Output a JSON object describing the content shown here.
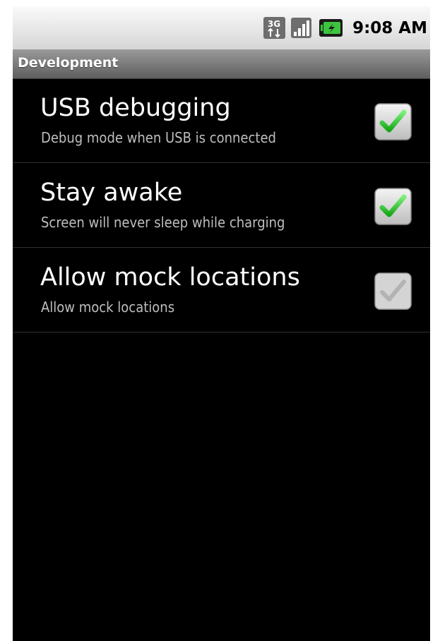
{
  "status_bar": {
    "time": "9:08 AM",
    "icons": [
      "3g-data-icon",
      "signal-strength-icon",
      "battery-charging-icon"
    ],
    "network_label": "3G"
  },
  "title_bar": {
    "title": "Development"
  },
  "preferences": [
    {
      "title": "USB debugging",
      "summary": "Debug mode when USB is connected",
      "checked": true,
      "enabled": true
    },
    {
      "title": "Stay awake",
      "summary": "Screen will never sleep while charging",
      "checked": true,
      "enabled": true
    },
    {
      "title": "Allow mock locations",
      "summary": "Allow mock locations",
      "checked": true,
      "enabled": false
    }
  ],
  "colors": {
    "background": "#000000",
    "status_bar": "#e8e8e8",
    "title_bar": "#7a7a7a",
    "check_green": "#22c422",
    "summary_text": "#bebebe"
  }
}
